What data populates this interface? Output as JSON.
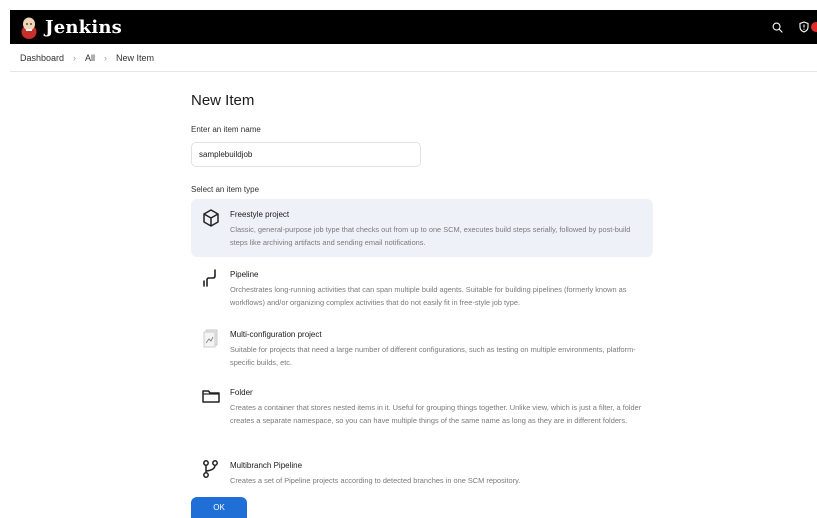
{
  "header": {
    "brand": "Jenkins",
    "icons": [
      "jenkins-logo-icon",
      "search-icon",
      "shield-icon"
    ],
    "alert_color": "#e02b2b"
  },
  "breadcrumb": {
    "items": [
      "Dashboard",
      "All",
      "New Item"
    ]
  },
  "page": {
    "title": "New Item",
    "name_label": "Enter an item name",
    "name_value": "samplebuildjob",
    "type_label": "Select an item type"
  },
  "item_types": [
    {
      "name": "Freestyle project",
      "description": "Classic, general-purpose job type that checks out from up to one SCM, executes build steps serially, followed by post-build steps like archiving artifacts and sending email notifications.",
      "icon": "freestyle-cube-icon",
      "selected": true
    },
    {
      "name": "Pipeline",
      "description": "Orchestrates long-running activities that can span multiple build agents. Suitable for building pipelines (formerly known as workflows) and/or organizing complex activities that do not easily fit in free-style job type.",
      "icon": "pipeline-icon",
      "selected": false
    },
    {
      "name": "Multi-configuration project",
      "description": "Suitable for projects that need a large number of different configurations, such as testing on multiple environments, platform-specific builds, etc.",
      "icon": "multi-configuration-icon",
      "selected": false
    },
    {
      "name": "Folder",
      "description": "Creates a container that stores nested items in it. Useful for grouping things together. Unlike view, which is just a filter, a folder creates a separate namespace, so you can have multiple things of the same name as long as they are in different folders.",
      "icon": "folder-icon",
      "selected": false
    },
    {
      "name": "Multibranch Pipeline",
      "description": "Creates a set of Pipeline projects according to detected branches in one SCM repository.",
      "icon": "branch-icon",
      "selected": false
    }
  ],
  "actions": {
    "ok_label": "OK",
    "ok_color": "#1f6fd6"
  }
}
